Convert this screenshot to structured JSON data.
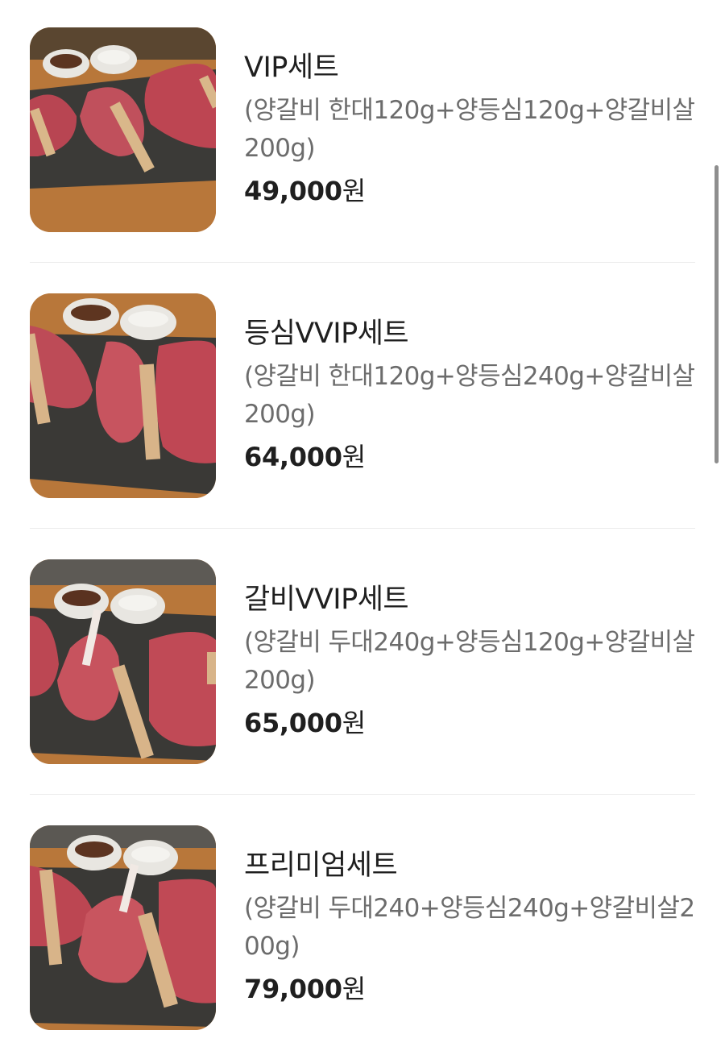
{
  "menu": {
    "items": [
      {
        "name": "VIP세트",
        "description": "(양갈비 한대120g+양등심120g+양갈비살200g)",
        "price_number": "49,000",
        "price_unit": "원",
        "image": "lamb-set-photo"
      },
      {
        "name": "등심VVIP세트",
        "description": "(양갈비 한대120g+양등심240g+양갈비살200g)",
        "price_number": "64,000",
        "price_unit": "원",
        "image": "lamb-set-photo"
      },
      {
        "name": "갈비VVIP세트",
        "description": "(양갈비 두대240g+양등심120g+양갈비살200g)",
        "price_number": "65,000",
        "price_unit": "원",
        "image": "lamb-set-photo"
      },
      {
        "name": "프리미엄세트",
        "description": "(양갈비 두대240+양등심240g+양갈비살200g)",
        "price_number": "79,000",
        "price_unit": "원",
        "image": "lamb-set-photo"
      }
    ]
  },
  "colors": {
    "text_primary": "#1f1f1f",
    "text_secondary": "#6c6c6c",
    "divider": "#ececec",
    "scrollbar": "#8e8e8e"
  }
}
